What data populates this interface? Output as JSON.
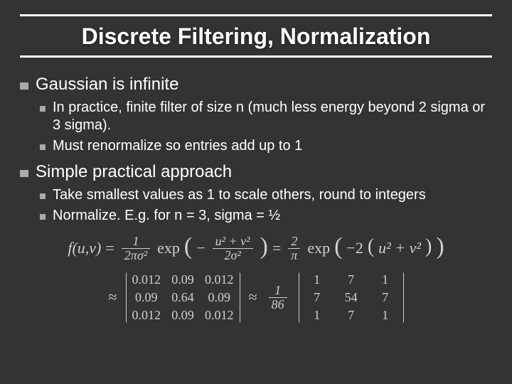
{
  "title": "Discrete Filtering, Normalization",
  "bullets": {
    "b1": "Gaussian is infinite",
    "b1_1": "In practice, finite filter of size n (much less energy beyond 2 sigma or 3 sigma).",
    "b1_2": "Must renormalize so entries add up to 1",
    "b2": "Simple practical approach",
    "b2_1": "Take smallest values as 1 to scale others, round to integers",
    "b2_2": "Normalize.  E.g. for n = 3, sigma = ½"
  },
  "formula": {
    "lhs": "f(u,v)",
    "eq": "=",
    "f1_num": "1",
    "f1_den": "2πσ²",
    "exp1": "exp",
    "f2_num": "u² + v²",
    "f2_den": "2σ²",
    "neg": "−",
    "eq2": "=",
    "f3_num": "2",
    "f3_den": "π",
    "exp2": "exp",
    "inner": "−2",
    "inner2": "u² + v²"
  },
  "matrix1": {
    "r0c0": "0.012",
    "r0c1": "0.09",
    "r0c2": "0.012",
    "r1c0": "0.09",
    "r1c1": "0.64",
    "r1c2": "0.09",
    "r2c0": "0.012",
    "r2c1": "0.09",
    "r2c2": "0.012"
  },
  "scalar": {
    "num": "1",
    "den": "86"
  },
  "matrix2": {
    "r0c0": "1",
    "r0c1": "7",
    "r0c2": "1",
    "r1c0": "7",
    "r1c1": "54",
    "r1c2": "7",
    "r2c0": "1",
    "r2c1": "7",
    "r2c2": "1"
  },
  "sym": {
    "approx": "≈"
  }
}
